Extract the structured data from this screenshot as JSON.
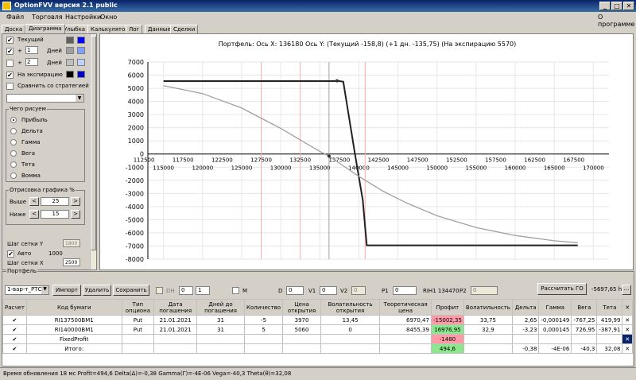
{
  "app": {
    "title": "OptionFVV версия 2.1 public"
  },
  "menu": {
    "file": "Файл",
    "trade": "Торговля",
    "settings": "Настройки",
    "window": "Окно",
    "about": "О программе"
  },
  "tabs": [
    "Доска",
    "Диаграмма",
    "Улыбка",
    "Калькулятор",
    "Лог",
    "Данные",
    "Сделки"
  ],
  "left": {
    "current": "Текущий",
    "plus_sign": "+",
    "plus1_value": "1",
    "plus2_value": "2",
    "days": "Дней",
    "expiration": "На экспирацию",
    "compare": "Сравнить со стратегией",
    "draw_group": "Чего рисуем",
    "radio_items": [
      "Прибыль",
      "Дельта",
      "Гамма",
      "Вега",
      "Тета",
      "Вомма"
    ],
    "render_group": "Отрисовка графика %",
    "above": "Выше",
    "above_value": "25",
    "below": "Ниже",
    "below_value": "15",
    "spin_left": "<",
    "spin_right": ">",
    "grid_y": "Шаг сетки Y",
    "grid_y_value": "1800",
    "auto": "Авто",
    "auto_value": "1000",
    "grid_x": "Шаг сетки X",
    "grid_x_value": "2500",
    "swatch_colors": [
      "#606060",
      "#0000ff",
      "#a0a0a0",
      "#80a0ff",
      "#c0c0c0",
      "#c0d0ff",
      "#000000",
      "#0000c0"
    ]
  },
  "chart_title": "Портфель: Ось X: 136180 Ось Y:  (Текущий -158,8)  (+1 дн. -135,75)  (На экспирацию 5570)",
  "chart_data": {
    "type": "line",
    "title": "Портфель: Ось X: 136180 Ось Y:  (Текущий -158,8)  (+1 дн. -135,75)  (На экспирацию 5570)",
    "xlabel": "",
    "ylabel": "",
    "xlim": [
      113000,
      172000
    ],
    "ylim": [
      -8000,
      7000
    ],
    "y_ticks": [
      7000,
      6000,
      5000,
      4000,
      3000,
      2000,
      1000,
      0,
      -1000,
      -2000,
      -3000,
      -4000,
      -5000,
      -6000,
      -7000,
      -8000
    ],
    "x_ticks_top": [
      112500,
      117500,
      122500,
      127500,
      132500,
      137500,
      142500,
      147500,
      152500,
      157500,
      162500,
      167500
    ],
    "x_ticks_bottom": [
      115000,
      120000,
      125000,
      130000,
      135000,
      140000,
      145000,
      150000,
      155000,
      160000,
      165000,
      170000
    ],
    "series": [
      {
        "color": "#222222",
        "x": [
          115000,
          137500,
          138000,
          139500,
          140500,
          141000,
          142000,
          168000
        ],
        "y": [
          5550,
          5550,
          5500,
          0,
          -3500,
          -6950,
          -6950,
          -6950
        ]
      },
      {
        "color": "#a0a0a0",
        "x": [
          115000,
          120000,
          125000,
          130000,
          133000,
          135000,
          136180,
          138000,
          140000,
          143000,
          146000,
          150000,
          155000,
          160000,
          165000,
          168000
        ],
        "y": [
          5200,
          4600,
          3500,
          1950,
          900,
          200,
          -159,
          -900,
          -1700,
          -2800,
          -3700,
          -4700,
          -5600,
          -6200,
          -6600,
          -6750
        ]
      }
    ],
    "vlines": [
      {
        "x": 136180,
        "color": "#a0a0a0"
      },
      {
        "x": 127500,
        "color": "#ffaaaa"
      },
      {
        "x": 132500,
        "color": "#ffaaaa"
      },
      {
        "x": 140800,
        "color": "#ffaaaa"
      }
    ],
    "markers": [
      {
        "x": 137200,
        "y": 5570
      },
      {
        "x": 136180,
        "y": -159
      }
    ],
    "grid": true
  },
  "portfolio": {
    "label": "Портфель",
    "name_select": "1-вар-т_РТС",
    "import_btn": "Импорт",
    "delete_btn": "Удалить",
    "save_btn": "Сохранить",
    "dh_label": "DH",
    "dh_val1": "0",
    "dh_val2": "1",
    "m_label": "M",
    "d_label": "D",
    "d_value": "0",
    "v1_label": "V1",
    "v1_value": "0",
    "v2_label": "V2",
    "v2_value": "0",
    "p1_label": "P1",
    "p1_value": "0",
    "ticker": "RIH1 134470",
    "p2_label": "P2",
    "p2_value": "0",
    "calc_btn": "Рассчитать ГО",
    "go_value": "-5697,65 h.",
    "small_btn": "..."
  },
  "grid": {
    "headers": [
      "Расчет",
      "Код бумаги",
      "Тип опциона",
      "Дата погашения",
      "Дней до погашения",
      "Количество",
      "Цена открытия",
      "Волатильность открытия",
      "Теоретическая цена",
      "Профит",
      "Волатильность",
      "Дельта",
      "Гамма",
      "Вега",
      "Тета",
      "✕"
    ],
    "rows": [
      {
        "check": "✔",
        "code": "RI137500BM1",
        "type": "Put",
        "date": "21.01.2021",
        "days": "31",
        "qty": "-5",
        "price": "3970",
        "vol_open": "13,45",
        "theo": "6970,47",
        "profit": "-15002,35",
        "vol": "33,75",
        "delta": "2,65",
        "gamma": "-0,000149",
        "vega": "-767,25",
        "theta": "419,99",
        "x": "✕"
      },
      {
        "check": "✔",
        "code": "RI140000BM1",
        "type": "Put",
        "date": "21.01.2021",
        "days": "31",
        "qty": "5",
        "price": "5060",
        "vol_open": "0",
        "theo": "8455,39",
        "profit": "16976,95",
        "vol": "32,9",
        "delta": "-3,23",
        "gamma": "0,000145",
        "vega": "726,95",
        "theta": "-387,91",
        "x": "✕"
      },
      {
        "check": "✔",
        "code": "FixedProfit",
        "type": "",
        "date": "",
        "days": "",
        "qty": "",
        "price": "",
        "vol_open": "",
        "theo": "",
        "profit": "-1480",
        "vol": "",
        "delta": "",
        "gamma": "",
        "vega": "",
        "theta": "",
        "x": "✕"
      },
      {
        "check": "✔",
        "code": "Итого:",
        "type": "",
        "date": "",
        "days": "",
        "qty": "",
        "price": "",
        "vol_open": "",
        "theo": "",
        "profit": "494,6",
        "vol": "",
        "delta": "-0,38",
        "gamma": "-4E-06",
        "vega": "-40,3",
        "theta": "32,08",
        "x": "✕"
      }
    ]
  },
  "status": "Время обновления 18 мс  Profit=494,6 Delta(Δ)=-0,38 Gamma(Γ)=-4E-06 Vega=-40,3 Theta(θ)=32,08"
}
